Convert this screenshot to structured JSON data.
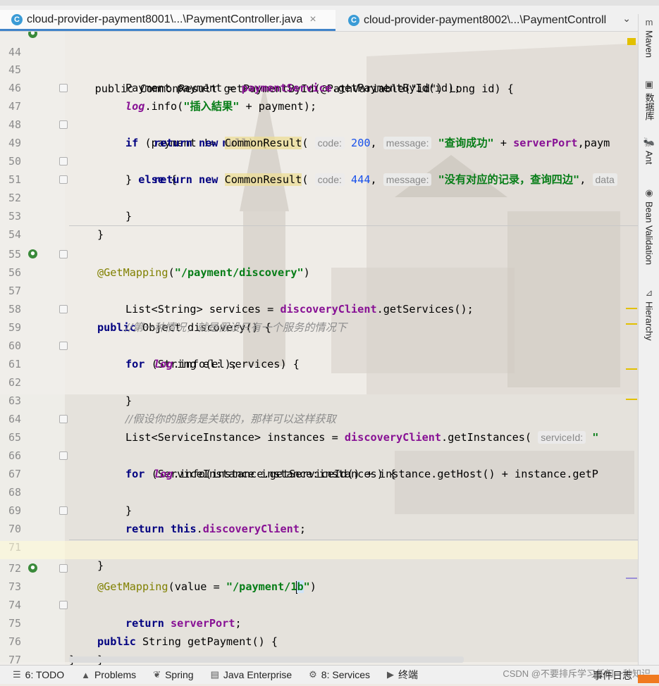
{
  "tabs": [
    {
      "label": "cloud-provider-payment8001\\...\\PaymentController.java",
      "close": "×",
      "icon": "C"
    },
    {
      "label": "cloud-provider-payment8002\\...\\PaymentControll",
      "icon": "C"
    }
  ],
  "tab_dropdown": "⌄",
  "code": {
    "l44": {
      "num": "44",
      "pre": "    public CommonResult getPaymentById(@PathVariable(\"id\") Long id) {"
    },
    "l45": {
      "num": "45",
      "a": "Payment payment = ",
      "b": "paymentService",
      "c": ".getPaymentById(id);"
    },
    "l46": {
      "num": "46",
      "a": "log",
      "b": ".info(",
      "c": "\"插入結果\"",
      "d": " + payment);"
    },
    "l47": {
      "num": "47",
      "kw": "if",
      "a": " (payment != ",
      "null": "null",
      "b": ") {"
    },
    "l48": {
      "num": "48",
      "kw1": "return",
      "kw2": " new ",
      "cls": "CommonResult",
      "p": "(",
      "h1": "code:",
      "n": "200",
      "h2": "message:",
      "s": "\"查询成功\"",
      "plus": " + ",
      "f": "serverPort",
      "tail": ",paym"
    },
    "l49": {
      "num": "49",
      "a": "} ",
      "kw": "else",
      "b": " {"
    },
    "l50": {
      "num": "50",
      "kw1": "return",
      "kw2": " new ",
      "cls": "CommonResult",
      "p": "(",
      "h1": "code:",
      "n": "444",
      "h2": "message:",
      "s": "\"没有对应的记录，查询四边\"",
      "c": ",",
      "h3": "data"
    },
    "l51": {
      "num": "51",
      "a": "}"
    },
    "l52": {
      "num": "52",
      "a": "}"
    },
    "l53": {
      "num": "53"
    },
    "l54": {
      "num": "54"
    },
    "l55": {
      "num": "55",
      "an": "@GetMapping",
      "a": "(",
      "s": "\"/payment/discovery\"",
      "b": ")"
    },
    "l56": {
      "num": "56",
      "kw": "public",
      "a": " Object discovery() {"
    },
    "l57": {
      "num": "57",
      "a": "List<String> services = ",
      "f": "discoveryClient",
      "b": ".getServices();"
    },
    "l58": {
      "num": "58",
      "cm": "//第一种情况，就是假设只有一个服务的情况下"
    },
    "l59": {
      "num": "59",
      "kw": "for",
      "a": " (String el: services) {"
    },
    "l60": {
      "num": "60",
      "lg": "log",
      "a": ".info(el);"
    },
    "l61": {
      "num": "61",
      "a": "}"
    },
    "l62": {
      "num": "62"
    },
    "l63": {
      "num": "63",
      "cm": "//假设你的服务是关联的，那样可以这样获取"
    },
    "l64": {
      "num": "64",
      "a": "List<ServiceInstance> instances = ",
      "f": "discoveryClient",
      "b": ".getInstances(",
      "h": "serviceId:",
      "c": " \""
    },
    "l65": {
      "num": "65",
      "kw": "for",
      "a": " (ServiceInstance instance:instances) {"
    },
    "l66": {
      "num": "66",
      "lg": "log",
      "a": ".info(instance.getServiceId() + instance.getHost() + instance.getP"
    },
    "l67": {
      "num": "67",
      "a": "}"
    },
    "l68": {
      "num": "68"
    },
    "l69": {
      "num": "69",
      "kw1": "return",
      "kw2": " this",
      "a": ".",
      "f": "discoveryClient",
      "b": ";"
    },
    "l70": {
      "num": "70",
      "a": "}"
    },
    "l71": {
      "num": "71"
    },
    "l72": {
      "num": "72",
      "an": "@GetMapping",
      "a": "(value = ",
      "s1": "\"/payment/1",
      "s2": "b",
      "s3": "\"",
      "b": ")"
    },
    "l73": {
      "num": "73",
      "kw": "public",
      "a": " String getPayment() {"
    },
    "l74": {
      "num": "74",
      "kw": "return",
      "sp": " ",
      "f": "serverPort",
      "b": ";"
    },
    "l75": {
      "num": "75",
      "a": "}"
    },
    "l76": {
      "num": "76",
      "a": "}"
    },
    "l77": {
      "num": "77"
    }
  },
  "right_panel": [
    {
      "label": "Maven",
      "icon": "m"
    },
    {
      "label": "数据库",
      "icon": "▣"
    },
    {
      "label": "Ant",
      "icon": "🐜"
    },
    {
      "label": "Bean Validation",
      "icon": "◉"
    },
    {
      "label": "Hierarchy",
      "icon": "⊿"
    }
  ],
  "status_bar": {
    "todo": "6: TODO",
    "problems": "Problems",
    "spring": "Spring",
    "java_enterprise": "Java Enterprise",
    "services": "8: Services",
    "terminal": "终端",
    "event_log": "事件日志"
  },
  "watermark": "CSDN @不要排斥学习任何一种知识",
  "colors": {
    "keyword": "#000080",
    "string": "#067d17",
    "field": "#871094",
    "annotation": "#808000",
    "number": "#1750eb",
    "accent": "#4083c9"
  }
}
